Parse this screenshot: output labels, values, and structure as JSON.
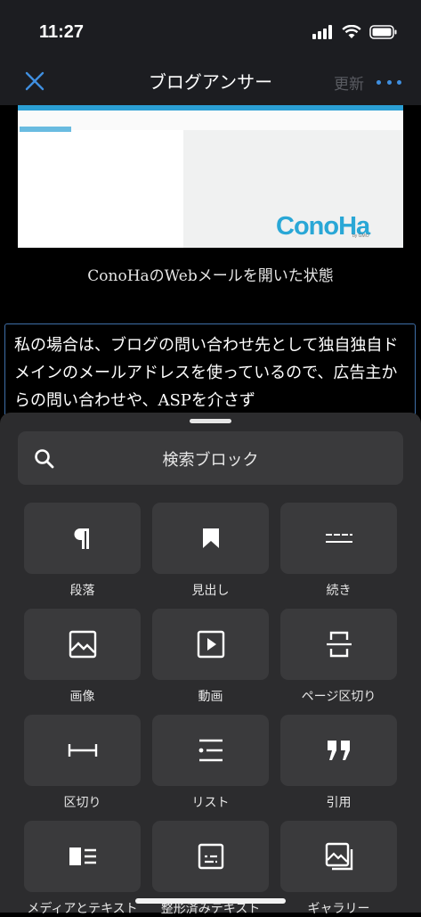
{
  "status": {
    "time": "11:27"
  },
  "nav": {
    "title": "ブログアンサー",
    "update": "更新"
  },
  "content": {
    "image": {
      "logo_text": "ConoHa",
      "logo_sub": "by GMO"
    },
    "caption": "ConoHaのWebメールを開いた状態",
    "paragraph": "私の場合は、ブログの問い合わせ先として独自独自ドメインのメールアドレスを使っているので、広告主からの問い合わせや、ASPを介さず"
  },
  "sheet": {
    "search_label": "検索ブロック",
    "blocks": [
      {
        "label": "段落",
        "icon": "paragraph-icon"
      },
      {
        "label": "見出し",
        "icon": "bookmark-icon"
      },
      {
        "label": "続き",
        "icon": "more-divider-icon"
      },
      {
        "label": "画像",
        "icon": "image-icon"
      },
      {
        "label": "動画",
        "icon": "video-icon"
      },
      {
        "label": "ページ区切り",
        "icon": "page-break-icon"
      },
      {
        "label": "区切り",
        "icon": "separator-icon"
      },
      {
        "label": "リスト",
        "icon": "list-icon"
      },
      {
        "label": "引用",
        "icon": "quote-icon"
      },
      {
        "label": "メディアとテキスト",
        "icon": "media-text-icon"
      },
      {
        "label": "整形済みテキスト",
        "icon": "preformatted-icon"
      },
      {
        "label": "ギャラリー",
        "icon": "gallery-icon"
      }
    ]
  }
}
